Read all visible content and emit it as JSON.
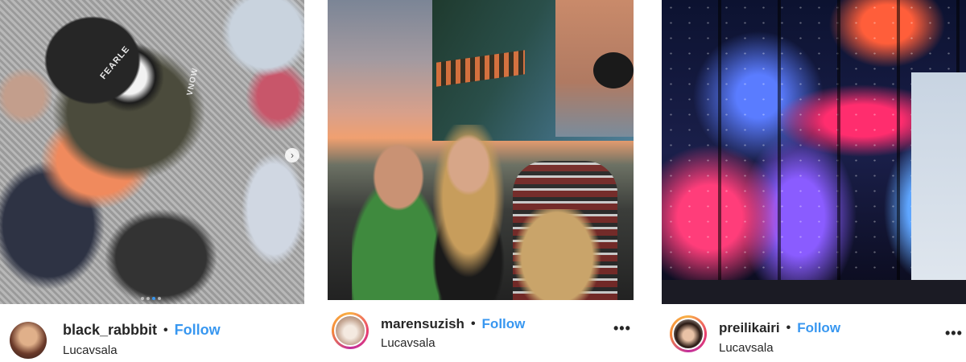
{
  "posts": [
    {
      "username": "black_rabbbit",
      "separator": "•",
      "follow_label": "Follow",
      "location": "Lucavsala",
      "photo_text": [
        "FEARLE",
        "VNOW"
      ],
      "carousel": {
        "current": 3,
        "total": 4
      },
      "has_more_menu": false
    },
    {
      "username": "marensuzish",
      "separator": "•",
      "follow_label": "Follow",
      "location": "Lucavsala",
      "more_label": "•••",
      "has_more_menu": true
    },
    {
      "username": "preilikairi",
      "separator": "•",
      "follow_label": "Follow",
      "location": "Lucavsala",
      "more_label": "•••",
      "has_more_menu": true
    }
  ],
  "icons": {
    "carousel_next": "chevron-right-icon",
    "more": "more-horizontal-icon"
  },
  "colors": {
    "follow": "#3897f0",
    "text": "#262626",
    "story_ring": [
      "#f9b046",
      "#e93f6d",
      "#c22f9c"
    ]
  }
}
